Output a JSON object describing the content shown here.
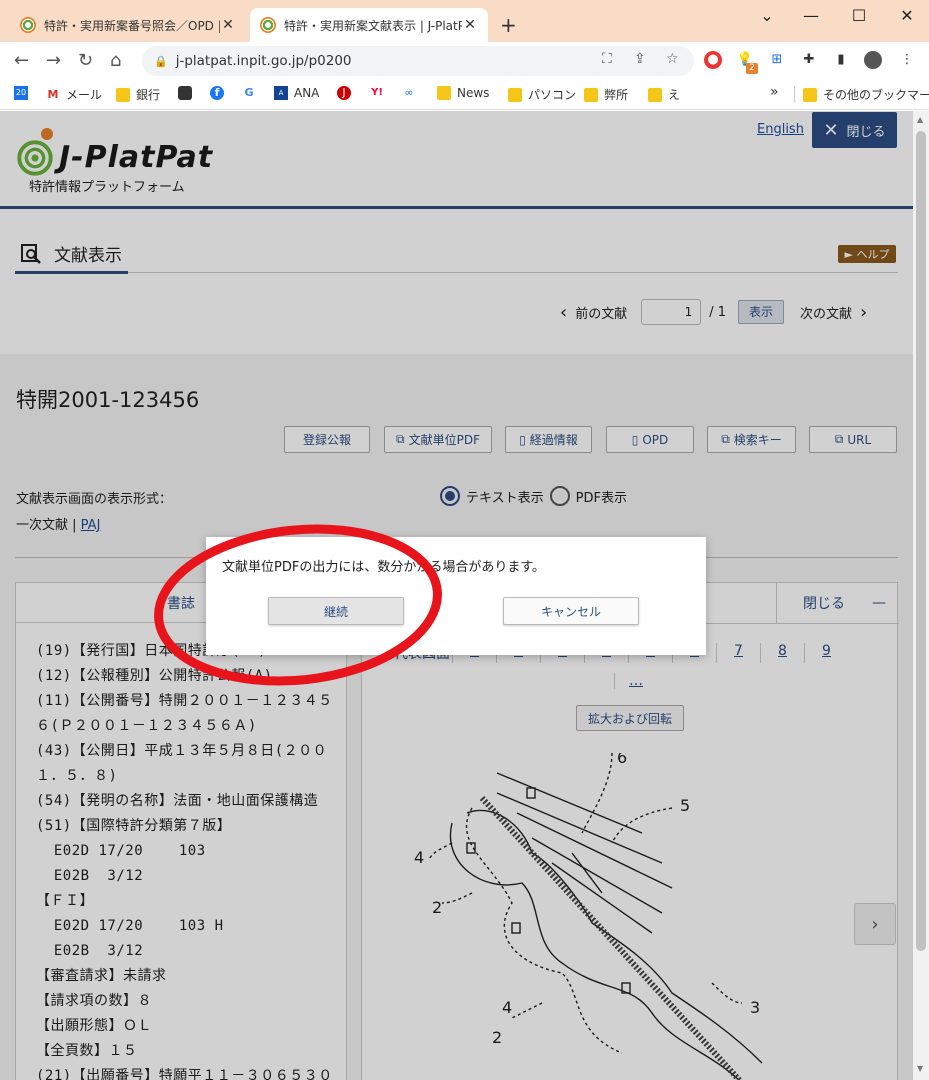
{
  "browser": {
    "tabs": [
      {
        "title": "特許・実用新案番号照会／OPD | J-P"
      },
      {
        "title": "特許・実用新案文献表示 | J-PlatPat"
      }
    ],
    "new_tab": "+",
    "url": "j-platpat.inpit.go.jp/p0200",
    "bookmarks": [
      {
        "label": "",
        "icon": "calendar-icon"
      },
      {
        "label": "メール",
        "icon": "gmail-icon"
      },
      {
        "label": "銀行",
        "icon": "folder-icon"
      },
      {
        "label": "",
        "icon": "app-icon"
      },
      {
        "label": "",
        "icon": "facebook-icon"
      },
      {
        "label": "",
        "icon": "google-icon"
      },
      {
        "label": "ANA",
        "icon": "ana-icon"
      },
      {
        "label": "",
        "icon": "jal-icon"
      },
      {
        "label": "",
        "icon": "yahoo-icon"
      },
      {
        "label": "",
        "icon": "link-icon"
      },
      {
        "label": "News",
        "icon": "folder-icon"
      },
      {
        "label": "パソコン",
        "icon": "folder-icon"
      },
      {
        "label": "弊所",
        "icon": "folder-icon"
      },
      {
        "label": "え",
        "icon": "folder-icon"
      }
    ],
    "bookmarks_more": "»",
    "other_bookmarks": "その他のブックマーク",
    "extension_badge": "2"
  },
  "header": {
    "logo_text": "J-PlatPat",
    "logo_sub": "特許情報プラットフォーム",
    "english_link": "English",
    "close_label": "閉じる"
  },
  "section": {
    "title": "文献表示",
    "help": "► ヘルプ"
  },
  "pager": {
    "prev": "前の文献",
    "current": "1",
    "total": "/ 1",
    "show": "表示",
    "next": "次の文献"
  },
  "document": {
    "title": "特開2001-123456",
    "actions": [
      "登録公報",
      "文献単位PDF",
      "経過情報",
      "OPD",
      "検索キー",
      "URL"
    ],
    "format_label": "文献表示画面の表示形式：",
    "format_primary": "一次文献",
    "format_sep": " | ",
    "format_paj": "PAJ",
    "radio_text": "テキスト表示",
    "radio_pdf": "PDF表示"
  },
  "left_panel": {
    "header": "書誌",
    "lines": [
      "(19)【発行国】日本国特許庁(JP)",
      "(12)【公報種別】公開特許公報(A)",
      "(11)【公開番号】特開２００１－１２３４５",
      "６(Ｐ２００１－１２３４５６Ａ)",
      "(43)【公開日】平成１３年５月８日(２００",
      "１．５．８)",
      "(54)【発明の名称】法面・地山面保護構造",
      "(51)【国際特許分類第７版】",
      "  E02D 17/20    103",
      "  E02B  3/12",
      "【ＦＩ】",
      "  E02D 17/20    103 H",
      "  E02B  3/12",
      "【審査請求】未請求",
      "【請求項の数】８",
      "【出願形態】ＯＬ",
      "【全頁数】１５",
      "(21)【出願番号】特願平１１－３０６５３０"
    ]
  },
  "right_panel": {
    "close": "閉じる",
    "collapse": "—",
    "first_label": "代表図面",
    "pages": [
      "1",
      "2",
      "3",
      "4",
      "5",
      "6",
      "7",
      "8",
      "9"
    ],
    "more": "…",
    "zoom_rotate": "拡大および回転",
    "next": "›",
    "figure_labels": [
      "6",
      "5",
      "4",
      "2",
      "2",
      "4",
      "3"
    ]
  },
  "dialog": {
    "message": "文献単位PDFの出力には、数分かかる場合があります。",
    "continue": "継続",
    "cancel": "キャンセル"
  },
  "colors": {
    "brand_navy": "#2d4e84",
    "help_brown": "#8a5a1b",
    "annotation_red": "#e8141c",
    "tabstrip": "#f8dcc6"
  }
}
